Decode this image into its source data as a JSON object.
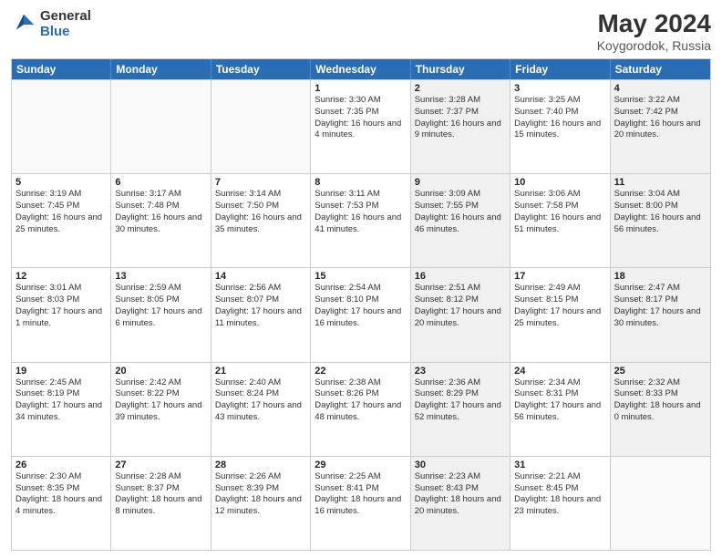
{
  "logo": {
    "general": "General",
    "blue": "Blue"
  },
  "title": "May 2024",
  "location": "Koygorodok, Russia",
  "days": [
    "Sunday",
    "Monday",
    "Tuesday",
    "Wednesday",
    "Thursday",
    "Friday",
    "Saturday"
  ],
  "weeks": [
    [
      {
        "day": "",
        "sunrise": "",
        "sunset": "",
        "daylight": "",
        "shaded": false,
        "empty": true
      },
      {
        "day": "",
        "sunrise": "",
        "sunset": "",
        "daylight": "",
        "shaded": false,
        "empty": true
      },
      {
        "day": "",
        "sunrise": "",
        "sunset": "",
        "daylight": "",
        "shaded": false,
        "empty": true
      },
      {
        "day": "1",
        "sunrise": "Sunrise: 3:30 AM",
        "sunset": "Sunset: 7:35 PM",
        "daylight": "Daylight: 16 hours and 4 minutes.",
        "shaded": false,
        "empty": false
      },
      {
        "day": "2",
        "sunrise": "Sunrise: 3:28 AM",
        "sunset": "Sunset: 7:37 PM",
        "daylight": "Daylight: 16 hours and 9 minutes.",
        "shaded": true,
        "empty": false
      },
      {
        "day": "3",
        "sunrise": "Sunrise: 3:25 AM",
        "sunset": "Sunset: 7:40 PM",
        "daylight": "Daylight: 16 hours and 15 minutes.",
        "shaded": false,
        "empty": false
      },
      {
        "day": "4",
        "sunrise": "Sunrise: 3:22 AM",
        "sunset": "Sunset: 7:42 PM",
        "daylight": "Daylight: 16 hours and 20 minutes.",
        "shaded": true,
        "empty": false
      }
    ],
    [
      {
        "day": "5",
        "sunrise": "Sunrise: 3:19 AM",
        "sunset": "Sunset: 7:45 PM",
        "daylight": "Daylight: 16 hours and 25 minutes.",
        "shaded": false,
        "empty": false
      },
      {
        "day": "6",
        "sunrise": "Sunrise: 3:17 AM",
        "sunset": "Sunset: 7:48 PM",
        "daylight": "Daylight: 16 hours and 30 minutes.",
        "shaded": false,
        "empty": false
      },
      {
        "day": "7",
        "sunrise": "Sunrise: 3:14 AM",
        "sunset": "Sunset: 7:50 PM",
        "daylight": "Daylight: 16 hours and 35 minutes.",
        "shaded": false,
        "empty": false
      },
      {
        "day": "8",
        "sunrise": "Sunrise: 3:11 AM",
        "sunset": "Sunset: 7:53 PM",
        "daylight": "Daylight: 16 hours and 41 minutes.",
        "shaded": false,
        "empty": false
      },
      {
        "day": "9",
        "sunrise": "Sunrise: 3:09 AM",
        "sunset": "Sunset: 7:55 PM",
        "daylight": "Daylight: 16 hours and 46 minutes.",
        "shaded": true,
        "empty": false
      },
      {
        "day": "10",
        "sunrise": "Sunrise: 3:06 AM",
        "sunset": "Sunset: 7:58 PM",
        "daylight": "Daylight: 16 hours and 51 minutes.",
        "shaded": false,
        "empty": false
      },
      {
        "day": "11",
        "sunrise": "Sunrise: 3:04 AM",
        "sunset": "Sunset: 8:00 PM",
        "daylight": "Daylight: 16 hours and 56 minutes.",
        "shaded": true,
        "empty": false
      }
    ],
    [
      {
        "day": "12",
        "sunrise": "Sunrise: 3:01 AM",
        "sunset": "Sunset: 8:03 PM",
        "daylight": "Daylight: 17 hours and 1 minute.",
        "shaded": false,
        "empty": false
      },
      {
        "day": "13",
        "sunrise": "Sunrise: 2:59 AM",
        "sunset": "Sunset: 8:05 PM",
        "daylight": "Daylight: 17 hours and 6 minutes.",
        "shaded": false,
        "empty": false
      },
      {
        "day": "14",
        "sunrise": "Sunrise: 2:56 AM",
        "sunset": "Sunset: 8:07 PM",
        "daylight": "Daylight: 17 hours and 11 minutes.",
        "shaded": false,
        "empty": false
      },
      {
        "day": "15",
        "sunrise": "Sunrise: 2:54 AM",
        "sunset": "Sunset: 8:10 PM",
        "daylight": "Daylight: 17 hours and 16 minutes.",
        "shaded": false,
        "empty": false
      },
      {
        "day": "16",
        "sunrise": "Sunrise: 2:51 AM",
        "sunset": "Sunset: 8:12 PM",
        "daylight": "Daylight: 17 hours and 20 minutes.",
        "shaded": true,
        "empty": false
      },
      {
        "day": "17",
        "sunrise": "Sunrise: 2:49 AM",
        "sunset": "Sunset: 8:15 PM",
        "daylight": "Daylight: 17 hours and 25 minutes.",
        "shaded": false,
        "empty": false
      },
      {
        "day": "18",
        "sunrise": "Sunrise: 2:47 AM",
        "sunset": "Sunset: 8:17 PM",
        "daylight": "Daylight: 17 hours and 30 minutes.",
        "shaded": true,
        "empty": false
      }
    ],
    [
      {
        "day": "19",
        "sunrise": "Sunrise: 2:45 AM",
        "sunset": "Sunset: 8:19 PM",
        "daylight": "Daylight: 17 hours and 34 minutes.",
        "shaded": false,
        "empty": false
      },
      {
        "day": "20",
        "sunrise": "Sunrise: 2:42 AM",
        "sunset": "Sunset: 8:22 PM",
        "daylight": "Daylight: 17 hours and 39 minutes.",
        "shaded": false,
        "empty": false
      },
      {
        "day": "21",
        "sunrise": "Sunrise: 2:40 AM",
        "sunset": "Sunset: 8:24 PM",
        "daylight": "Daylight: 17 hours and 43 minutes.",
        "shaded": false,
        "empty": false
      },
      {
        "day": "22",
        "sunrise": "Sunrise: 2:38 AM",
        "sunset": "Sunset: 8:26 PM",
        "daylight": "Daylight: 17 hours and 48 minutes.",
        "shaded": false,
        "empty": false
      },
      {
        "day": "23",
        "sunrise": "Sunrise: 2:36 AM",
        "sunset": "Sunset: 8:29 PM",
        "daylight": "Daylight: 17 hours and 52 minutes.",
        "shaded": true,
        "empty": false
      },
      {
        "day": "24",
        "sunrise": "Sunrise: 2:34 AM",
        "sunset": "Sunset: 8:31 PM",
        "daylight": "Daylight: 17 hours and 56 minutes.",
        "shaded": false,
        "empty": false
      },
      {
        "day": "25",
        "sunrise": "Sunrise: 2:32 AM",
        "sunset": "Sunset: 8:33 PM",
        "daylight": "Daylight: 18 hours and 0 minutes.",
        "shaded": true,
        "empty": false
      }
    ],
    [
      {
        "day": "26",
        "sunrise": "Sunrise: 2:30 AM",
        "sunset": "Sunset: 8:35 PM",
        "daylight": "Daylight: 18 hours and 4 minutes.",
        "shaded": false,
        "empty": false
      },
      {
        "day": "27",
        "sunrise": "Sunrise: 2:28 AM",
        "sunset": "Sunset: 8:37 PM",
        "daylight": "Daylight: 18 hours and 8 minutes.",
        "shaded": false,
        "empty": false
      },
      {
        "day": "28",
        "sunrise": "Sunrise: 2:26 AM",
        "sunset": "Sunset: 8:39 PM",
        "daylight": "Daylight: 18 hours and 12 minutes.",
        "shaded": false,
        "empty": false
      },
      {
        "day": "29",
        "sunrise": "Sunrise: 2:25 AM",
        "sunset": "Sunset: 8:41 PM",
        "daylight": "Daylight: 18 hours and 16 minutes.",
        "shaded": false,
        "empty": false
      },
      {
        "day": "30",
        "sunrise": "Sunrise: 2:23 AM",
        "sunset": "Sunset: 8:43 PM",
        "daylight": "Daylight: 18 hours and 20 minutes.",
        "shaded": true,
        "empty": false
      },
      {
        "day": "31",
        "sunrise": "Sunrise: 2:21 AM",
        "sunset": "Sunset: 8:45 PM",
        "daylight": "Daylight: 18 hours and 23 minutes.",
        "shaded": false,
        "empty": false
      },
      {
        "day": "",
        "sunrise": "",
        "sunset": "",
        "daylight": "",
        "shaded": true,
        "empty": true
      }
    ]
  ]
}
